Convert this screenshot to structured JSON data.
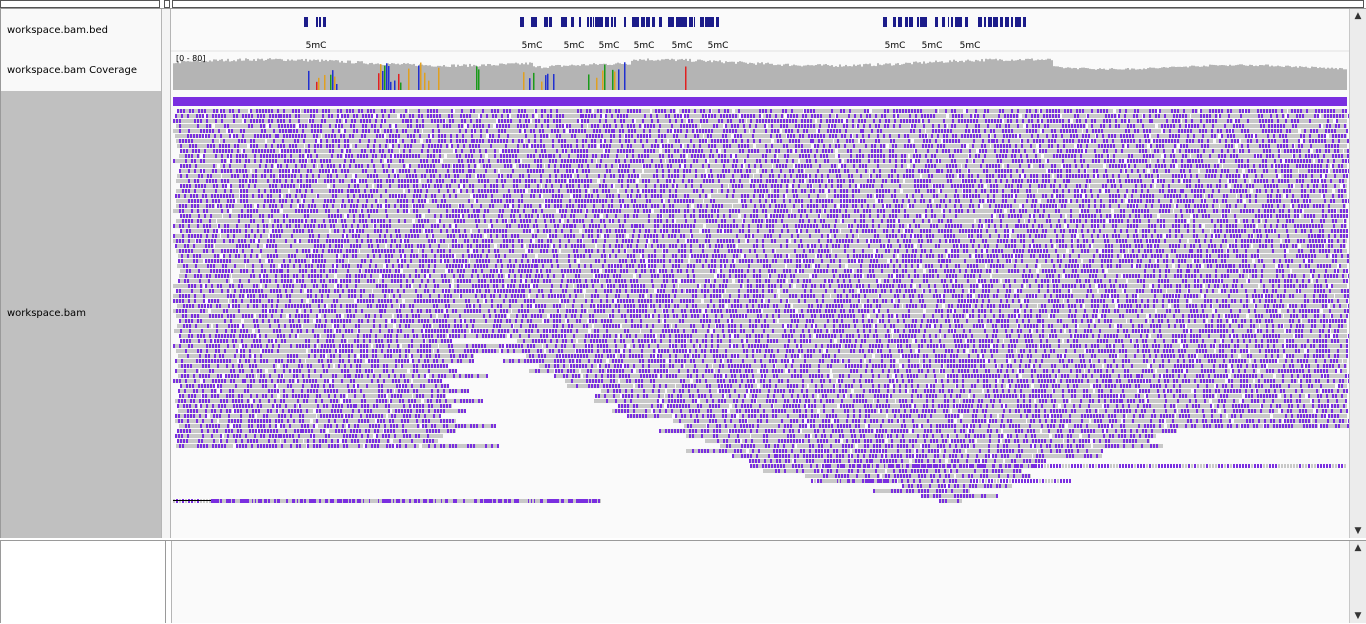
{
  "tracks": {
    "bed_name": "workspace.bam.bed",
    "coverage_name": "workspace.bam Coverage",
    "bam_name": "workspace.bam"
  },
  "coverage": {
    "range_label": "[0 - 80]"
  },
  "bed_features": {
    "label": "5mC",
    "label_count": 10
  },
  "colors": {
    "methylation_purple": "#7a2ee0",
    "read_gray": "#c8c8c8",
    "coverage_gray": "#b4b4b4",
    "bed_navy": "#1c1c8a",
    "mismatch_red": "#e02020",
    "mismatch_green": "#1a9a1a",
    "mismatch_blue": "#2030d0",
    "mismatch_orange": "#e0a020"
  },
  "scrollbar": {
    "up_icon": "arrow-up-icon",
    "down_icon": "arrow-down-icon"
  }
}
